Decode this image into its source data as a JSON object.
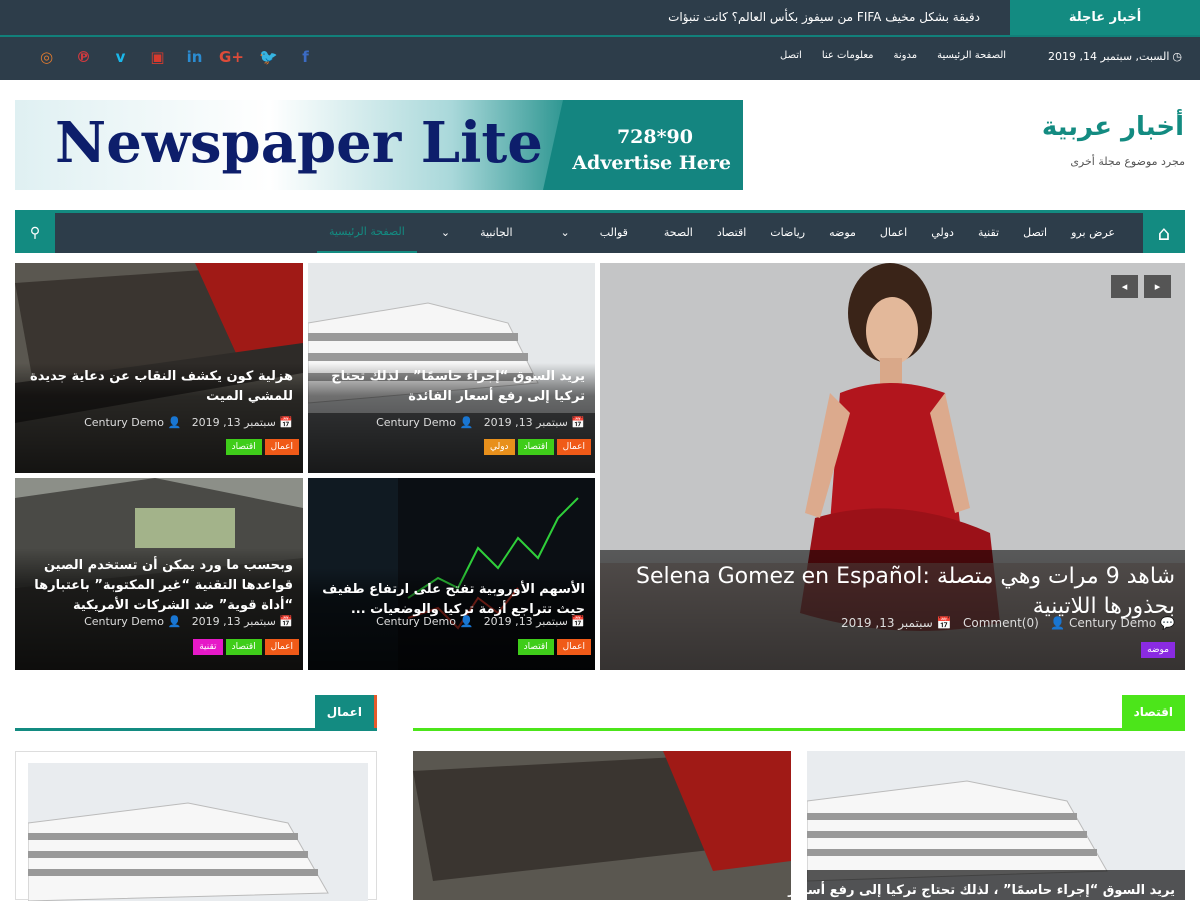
{
  "topbar": {
    "breaking_label": "أخبار عاجلة",
    "breaking_text": "دقيقة بشكل مخيف FIFA من سيفوز بكأس العالم؟ كانت تنبؤات"
  },
  "secbar": {
    "date": "السبت, سبتمبر 14, 2019",
    "nav": [
      "الصفحة الرئيسية",
      "مدونة",
      "معلومات عنا",
      "اتصل"
    ],
    "social": [
      {
        "name": "instagram-icon",
        "glyph": "◎",
        "color": "#e07a2f"
      },
      {
        "name": "pinterest-icon",
        "glyph": "℗",
        "color": "#d23a3f"
      },
      {
        "name": "vimeo-icon",
        "glyph": "v",
        "color": "#1ab7ea"
      },
      {
        "name": "youtube-icon",
        "glyph": "▣",
        "color": "#d63a2e"
      },
      {
        "name": "linkedin-icon",
        "glyph": "in",
        "color": "#2b8cd1"
      },
      {
        "name": "googleplus-icon",
        "glyph": "G+",
        "color": "#dd4b39"
      },
      {
        "name": "twitter-icon",
        "glyph": "🐦",
        "color": "#1da1f2"
      },
      {
        "name": "facebook-icon",
        "glyph": "f",
        "color": "#3b6bc4"
      }
    ]
  },
  "site": {
    "title": "أخبار عربية",
    "description": "مجرد موضوع مجلة أخرى"
  },
  "ad": {
    "title": "Newspaper Lite",
    "size": "728*90",
    "cta": "Advertise Here"
  },
  "mainnav": {
    "items": [
      "عرض برو",
      "اتصل",
      "تقنية",
      "دولي",
      "اعمال",
      "موضه",
      "رياضات",
      "اقتصاد",
      "الصحة",
      "قوالب",
      "الجانبية",
      "الصفحة الرئيسية"
    ]
  },
  "featured": {
    "title": "شاهد 9 مرات وهي متصلة :Selena Gomez en Español بحذورها اللاتينية",
    "date": "سبتمبر 13, 2019",
    "author": "Century Demo",
    "comments": "Comment(0)",
    "tag": "موضه",
    "tag_color": "#8a2be2"
  },
  "grid": [
    {
      "title": "يريد السوق “إجراء حاسمًا” ، لذلك تحتاج تركيا إلى رفع أسعار الفائدة",
      "date": "سبتمبر 13, 2019",
      "author": "Century Demo",
      "tags": [
        {
          "label": "اعمال",
          "color": "#f05a18"
        },
        {
          "label": "اقتصاد",
          "color": "#3fcd1a"
        },
        {
          "label": "دولي",
          "color": "#e8901c"
        }
      ]
    },
    {
      "title": "هزلية كون يكشف النقاب عن دعاية جديدة للمشي الميت",
      "date": "سبتمبر 13, 2019",
      "author": "Century Demo",
      "tags": [
        {
          "label": "اعمال",
          "color": "#f05a18"
        },
        {
          "label": "اقتصاد",
          "color": "#3fcd1a"
        }
      ]
    },
    {
      "title": "الأسهم الأوروبية تفتح على ارتفاع طفيف حيث تتراجع أزمة تركيا والوضعيات ...",
      "date": "سبتمبر 13, 2019",
      "author": "Century Demo",
      "tags": [
        {
          "label": "اعمال",
          "color": "#f05a18"
        },
        {
          "label": "اقتصاد",
          "color": "#3fcd1a"
        }
      ]
    },
    {
      "title": "وبحسب ما ورد يمكن أن تستخدم الصين قواعدها التقنية “غير المكتوبة” باعتبارها “أداة قوية” ضد الشركات الأمريكية",
      "date": "سبتمبر 13, 2019",
      "author": "Century Demo",
      "tags": [
        {
          "label": "اعمال",
          "color": "#f05a18"
        },
        {
          "label": "اقتصاد",
          "color": "#3fcd1a"
        },
        {
          "label": "تقنية",
          "color": "#e619c8"
        }
      ]
    }
  ],
  "sections": {
    "economy": {
      "label": "اقتصاد",
      "color": "#4ce51a"
    },
    "business": {
      "label": "اعمال",
      "color": "#138b81"
    }
  },
  "bottom": {
    "card_title": "يريد السوق “إجراء حاسمًا” ، لذلك تحتاج تركيا إلى رفع أسعار"
  }
}
